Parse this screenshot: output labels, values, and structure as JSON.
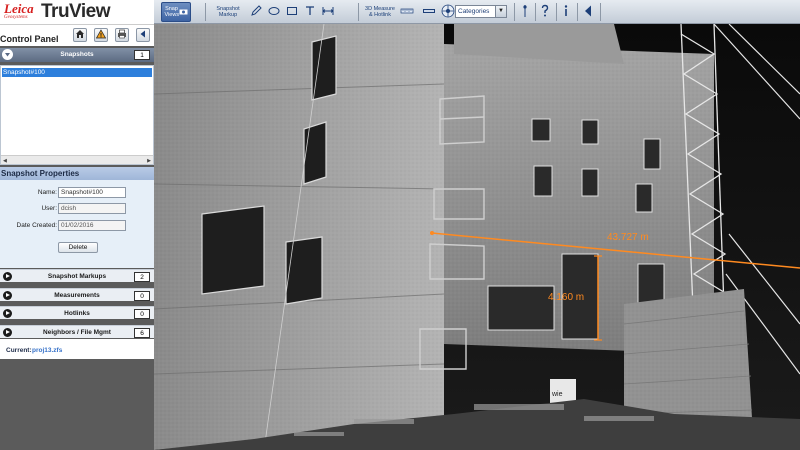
{
  "brand": {
    "company": "Leica",
    "subbrand": "Geosystems",
    "product": "TruView"
  },
  "control_panel": {
    "title": "Control Panel",
    "icons": [
      "home-icon",
      "warning-icon",
      "print-icon",
      "collapse-left-icon"
    ]
  },
  "snapshots": {
    "title": "Snapshots",
    "count": "1",
    "items": [
      "Snapshot#100"
    ]
  },
  "snapshot_properties": {
    "title": "Snapshot Properties",
    "name_label": "Name:",
    "name_value": "Snapshot#100",
    "user_label": "User:",
    "user_value": "dcish",
    "date_label": "Date Created:",
    "date_value": "01/02/2016",
    "delete_label": "Delete"
  },
  "sections": [
    {
      "label": "Snapshot Markups",
      "count": "2"
    },
    {
      "label": "Measurements",
      "count": "0"
    },
    {
      "label": "Hotlinks",
      "count": "0"
    },
    {
      "label": "Neighbors / File Mgmt",
      "count": "6"
    }
  ],
  "current": {
    "label": "Current:",
    "value": "proj13.zfs"
  },
  "toolbar": {
    "snap_views_label": "Snap Views",
    "snapshot_markup_label": "Snapshot Markup",
    "measure_label": "3D Measure & Hotlink",
    "categories_value": "Categories",
    "icons": [
      "pencil-icon",
      "ellipse-icon",
      "rectangle-icon",
      "text-icon",
      "dimension-icon",
      "measure-icon",
      "distance-icon",
      "target-icon",
      "pin-icon",
      "help-icon",
      "info-icon",
      "back-icon"
    ]
  },
  "scene": {
    "measurements": [
      "43.727 m",
      "4.160 m"
    ],
    "site_sign": "wie"
  },
  "colors": {
    "accent": "#2d7fdc",
    "measurement": "#ff8a20",
    "header": "#6c7b93"
  }
}
